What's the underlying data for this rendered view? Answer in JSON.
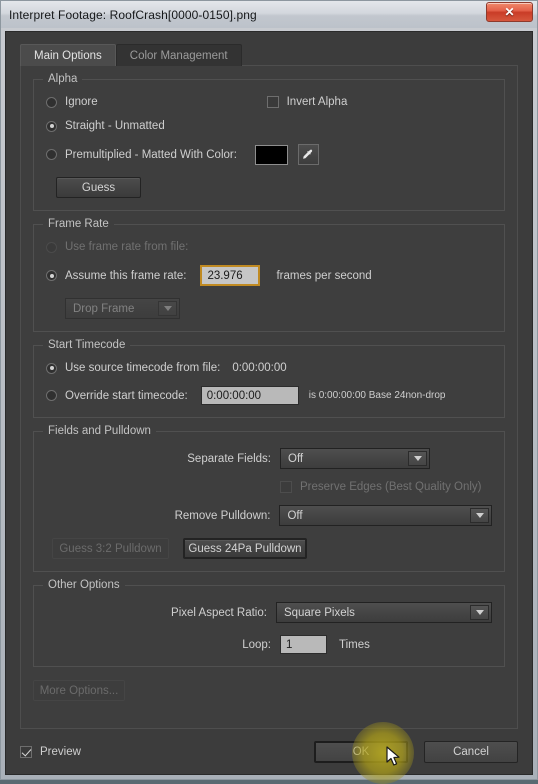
{
  "window": {
    "title": "Interpret Footage: RoofCrash[0000-0150].png",
    "close_label": "✕"
  },
  "tabs": [
    {
      "label": "Main Options",
      "active": true
    },
    {
      "label": "Color Management",
      "active": false
    }
  ],
  "alpha": {
    "legend": "Alpha",
    "ignore_label": "Ignore",
    "invert_label": "Invert Alpha",
    "invert_checked": false,
    "straight_label": "Straight - Unmatted",
    "premultiplied_label": "Premultiplied - Matted With Color:",
    "matte_color": "#000000",
    "eyedropper_icon": "eyedropper-icon",
    "guess_label": "Guess",
    "selected": "straight"
  },
  "frame_rate": {
    "legend": "Frame Rate",
    "use_from_file_label": "Use frame rate from file:",
    "assume_label": "Assume this frame rate:",
    "assume_value": "23.976",
    "fps_label": "frames per second",
    "drop_frame_value": "Drop Frame",
    "selected": "assume"
  },
  "start_timecode": {
    "legend": "Start Timecode",
    "use_source_label": "Use source timecode from file:",
    "source_value": "0:00:00:00",
    "override_label": "Override start timecode:",
    "override_value": "0:00:00:00",
    "info_text": "is 0:00:00:00  Base 24non-drop",
    "selected": "use_source"
  },
  "fields_pulldown": {
    "legend": "Fields and Pulldown",
    "separate_fields_label": "Separate Fields:",
    "separate_fields_value": "Off",
    "preserve_edges_label": "Preserve Edges (Best Quality Only)",
    "preserve_edges_checked": false,
    "remove_pulldown_label": "Remove Pulldown:",
    "remove_pulldown_value": "Off",
    "guess_32_label": "Guess 3:2 Pulldown",
    "guess_24pa_label": "Guess 24Pa Pulldown"
  },
  "other_options": {
    "legend": "Other Options",
    "par_label": "Pixel Aspect Ratio:",
    "par_value": "Square Pixels",
    "loop_label": "Loop:",
    "loop_value": "1",
    "times_label": "Times",
    "more_options_label": "More Options..."
  },
  "footer": {
    "preview_label": "Preview",
    "preview_checked": true,
    "ok_label": "OK",
    "cancel_label": "Cancel"
  },
  "colors": {
    "accent_focus": "#c08a22",
    "cursor_highlight": "#bdaf1e",
    "panel_bg": "#3e3e3e",
    "close_button": "#d6573d"
  }
}
